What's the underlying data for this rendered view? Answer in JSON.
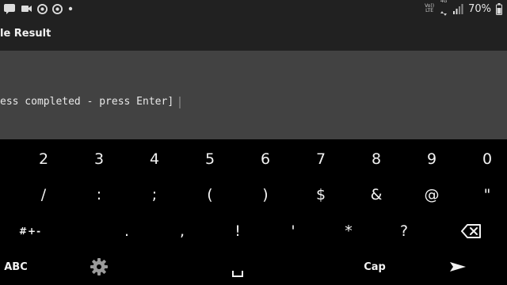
{
  "status_bar": {
    "notification_icons": [
      "sms-icon",
      "video-icon",
      "chrome-icon",
      "chrome-icon",
      "dot-icon"
    ],
    "network_volte": "Vo))",
    "network_lte": "LTE",
    "network_4g": "4G",
    "battery_percent": "70%"
  },
  "app": {
    "title": "le Result"
  },
  "terminal": {
    "line": "ess completed - press Enter]"
  },
  "keyboard": {
    "row1": [
      "2",
      "3",
      "4",
      "5",
      "6",
      "7",
      "8",
      "9",
      "0"
    ],
    "row2": [
      "/",
      ":",
      ";",
      "(",
      ")",
      "$",
      "&",
      "@",
      "\""
    ],
    "row3_mode": "#+-",
    "row3": [
      ".",
      ",",
      "!",
      "'",
      "*",
      "?"
    ],
    "row3_backspace_icon": "backspace-icon",
    "row4_abc": "ABC",
    "row4_settings_icon": "gear-icon",
    "row4_space_icon": "space-icon",
    "row4_cap": "Cap",
    "row4_enter_icon": "send-arrow-icon"
  },
  "colors": {
    "status_bar_bg": "#212121",
    "terminal_bg": "#424242",
    "keyboard_bg": "#000000",
    "key_text": "#f2f2f2"
  }
}
